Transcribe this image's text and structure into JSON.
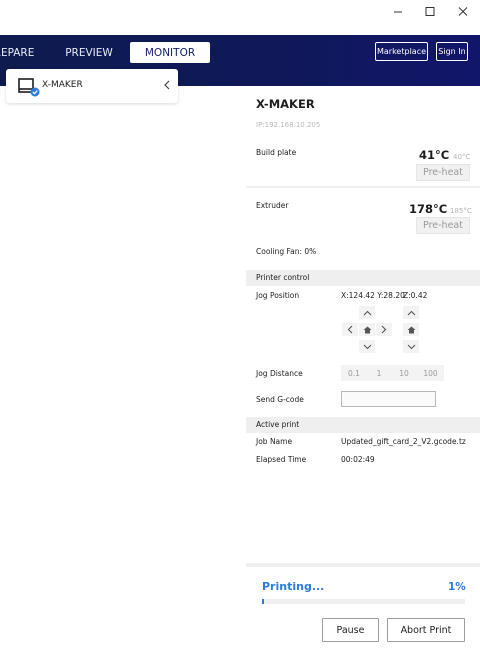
{
  "window": {
    "minimize_icon": "minimize-icon",
    "maximize_icon": "maximize-icon",
    "close_icon": "close-icon"
  },
  "header": {
    "tabs": [
      {
        "label": "REPARE",
        "active": false
      },
      {
        "label": "PREVIEW",
        "active": false
      },
      {
        "label": "MONITOR",
        "active": true
      }
    ],
    "marketplace_label": "Marketplace",
    "signin_label": "Sign In",
    "colors": {
      "header_bg": "#10185a",
      "active_tab_text": "#14206a"
    }
  },
  "printer_selector": {
    "name": "X-MAKER",
    "icon": "printer-connected-icon",
    "collapse_icon": "chevron-left-icon"
  },
  "printer": {
    "name": "X-MAKER",
    "ip": "IP:192.168.10.205"
  },
  "build_plate": {
    "label": "Build plate",
    "current_temp": "41°C",
    "target_temp": "40°C",
    "preheat_label": "Pre-heat"
  },
  "extruder": {
    "label": "Extruder",
    "current_temp": "178°C",
    "target_temp": "185°C",
    "preheat_label": "Pre-heat"
  },
  "cooling_fan": "Cooling Fan: 0%",
  "printer_control": {
    "section_title": "Printer control",
    "jog_position_label": "Jog Position",
    "position_xy": "X:124.42 Y:28.20",
    "position_z": "Z:0.42",
    "jog_distance_label": "Jog Distance",
    "jog_distances": [
      "0.1",
      "1",
      "10",
      "100"
    ],
    "send_gcode_label": "Send G-code",
    "send_gcode_value": ""
  },
  "active_print": {
    "section_title": "Active print",
    "job_name_label": "Job Name",
    "job_name": "Updated_gift_card_2_V2.gcode.tz",
    "elapsed_label": "Elapsed Time",
    "elapsed": "00:02:49"
  },
  "progress": {
    "status": "Printing...",
    "percent_text": "1%",
    "fraction": 0.01,
    "color": "#2d7bde"
  },
  "actions": {
    "pause_label": "Pause",
    "abort_label": "Abort Print"
  }
}
